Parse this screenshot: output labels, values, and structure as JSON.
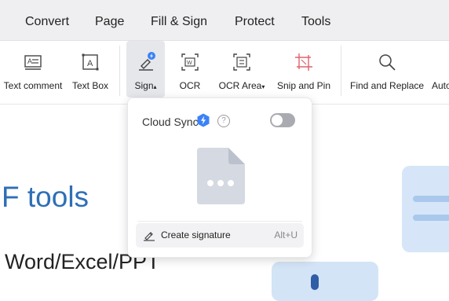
{
  "menu": {
    "items": [
      {
        "label": "Convert"
      },
      {
        "label": "Page"
      },
      {
        "label": "Fill & Sign"
      },
      {
        "label": "Protect"
      },
      {
        "label": "Tools"
      }
    ]
  },
  "ribbon": {
    "tools": [
      {
        "label": "Text comment"
      },
      {
        "label": "Text Box"
      },
      {
        "label": "Sign"
      },
      {
        "label": "OCR"
      },
      {
        "label": "OCR Area"
      },
      {
        "label": "Snip and Pin"
      },
      {
        "label": "Find and Replace"
      },
      {
        "label": "Auto"
      }
    ]
  },
  "document": {
    "heading": "F tools",
    "subheading": "Word/Excel/PPT"
  },
  "popup": {
    "cloud_sync_label": "Cloud Sync",
    "help_glyph": "?",
    "cloud_sync_enabled": false,
    "create_signature_label": "Create signature",
    "create_signature_shortcut": "Alt+U"
  },
  "colors": {
    "accent": "#2d6fb6",
    "menubar_bg": "#efeff1",
    "badge_blue": "#3b82f6",
    "toggle_off": "#a9abb0"
  },
  "icons": {
    "text_comment": "text-comment-icon",
    "text_box": "text-box-icon",
    "sign": "sign-pen-icon",
    "ocr": "ocr-icon",
    "ocr_area": "ocr-area-icon",
    "snip_pin": "snip-pin-icon",
    "find_replace": "search-icon"
  }
}
